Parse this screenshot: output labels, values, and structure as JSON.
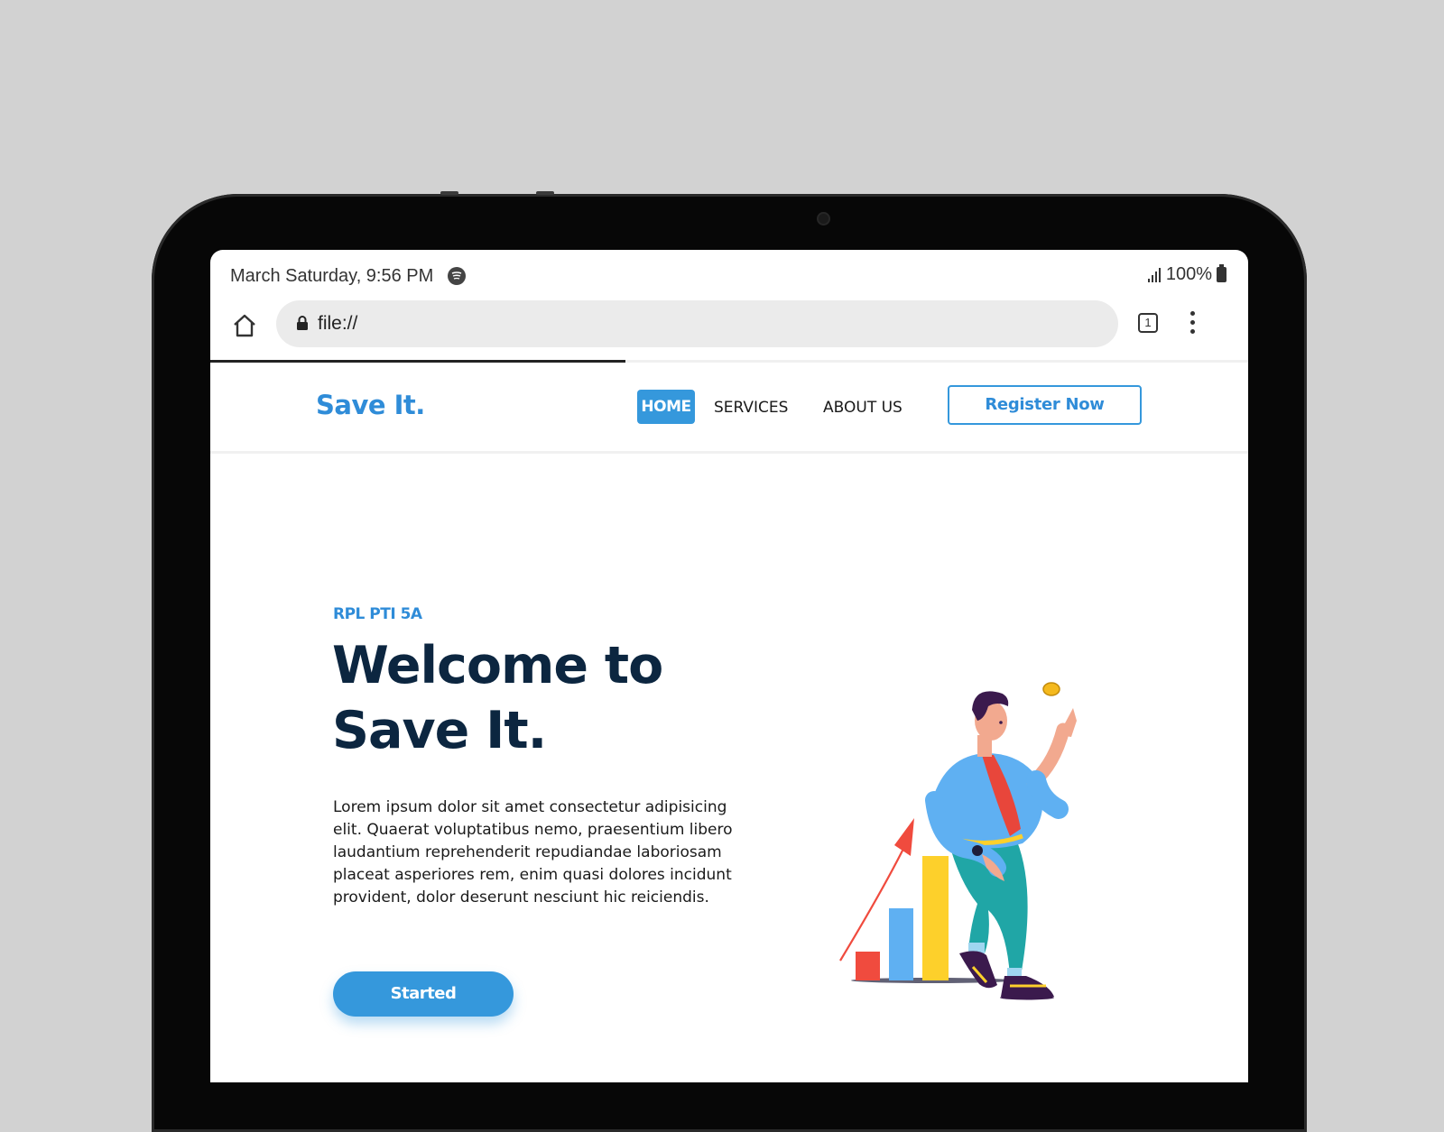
{
  "status_bar": {
    "time_text": "March Saturday, 9:56 PM",
    "battery_text": "100%",
    "icons": [
      "spotify-icon",
      "signal-icon",
      "battery-icon"
    ]
  },
  "browser": {
    "url": "file://",
    "tab_count": "1",
    "icons": [
      "home-icon",
      "lock-icon",
      "tabs-icon",
      "more-menu-icon"
    ]
  },
  "site": {
    "logo": "Save It.",
    "nav": {
      "home": "HOME",
      "services": "SERVICES",
      "about": "ABOUT US",
      "register": "Register Now"
    },
    "hero": {
      "eyebrow": "RPL PTI 5A",
      "title_line1": "Welcome to",
      "title_line2": "Save It.",
      "body": "Lorem ipsum dolor sit amet consectetur adipisicing elit. Quaerat voluptatibus nemo, praesentium libero laudantium reprehenderit repudiandae laboriosam placeat asperiores rem, enim quasi dolores incidunt provident, dolor deserunt nesciunt hic reiciendis.",
      "cta": "Started"
    }
  },
  "colors": {
    "brand_blue": "#3598dc",
    "title_navy": "#0c2640",
    "bezel": "#070707",
    "background": "#d2d2d2"
  }
}
